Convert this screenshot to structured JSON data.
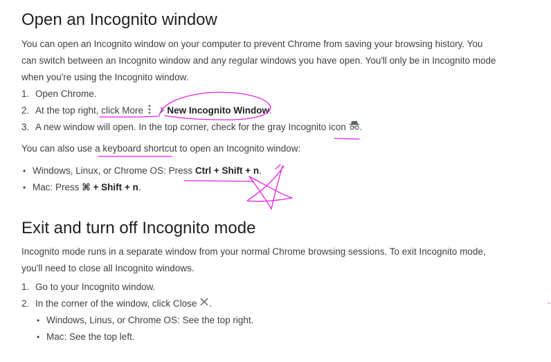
{
  "section1": {
    "title": "Open an Incognito window",
    "intro": "You can open an Incognito window on your computer to prevent Chrome from saving your browsing history. You can switch between an Incognito window and any regular windows you have open. You'll only be in Incognito mode when you're using the Incognito window.",
    "steps": [
      {
        "num": "1.",
        "text": "Open Chrome."
      },
      {
        "num": "2.",
        "prefix": "At the top right, click More",
        "bold": "New Incognito Window",
        "suffix": "."
      },
      {
        "num": "3.",
        "text": "A new window will open. In the top corner, check for the gray Incognito icon",
        "suffix": "."
      }
    ],
    "shortcut_intro": "You can also use a keyboard shortcut to open an Incognito window:",
    "shortcuts": [
      {
        "prefix": "Windows, Linux, or Chrome OS: Press ",
        "bold": "Ctrl + Shift + n",
        "suffix": "."
      },
      {
        "prefix": "Mac: Press ",
        "bold": "⌘ + Shift + n",
        "suffix": "."
      }
    ]
  },
  "section2": {
    "title": "Exit and turn off Incognito mode",
    "intro": "Incognito mode runs in a separate window from your normal Chrome browsing sessions. To exit Incognito mode, you'll need to close all Incognito windows.",
    "steps": [
      {
        "num": "1.",
        "text": "Go to your Incognito window."
      },
      {
        "num": "2.",
        "text": "In the corner of the window, click Close",
        "suffix": "."
      }
    ],
    "substeps": [
      "Windows, Linus, or Chrome OS: See the top right.",
      "Mac: See the top left."
    ]
  },
  "icons": {
    "more": "more-vert-icon",
    "chevron": "chevron-right-icon",
    "incognito": "incognito-icon",
    "close": "close-icon"
  },
  "colors": {
    "annotation": "#e61ee6",
    "text": "#3c4043",
    "icon": "#5f6368"
  }
}
